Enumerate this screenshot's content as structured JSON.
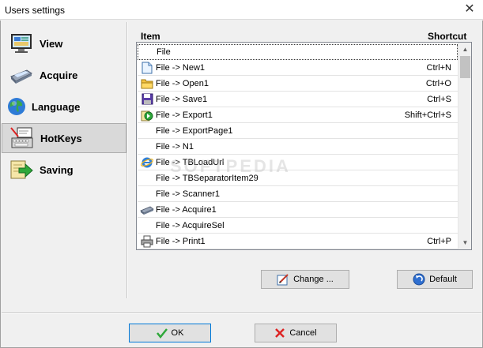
{
  "window": {
    "title": "Users settings",
    "close_glyph": "✕"
  },
  "sidebar": {
    "items": [
      {
        "label": "View",
        "icon": "monitor-icon"
      },
      {
        "label": "Acquire",
        "icon": "scanner-icon"
      },
      {
        "label": "Language",
        "icon": "globe-icon"
      },
      {
        "label": "HotKeys",
        "icon": "keyboard-icon",
        "selected": true
      },
      {
        "label": "Saving",
        "icon": "save-arrow-icon"
      }
    ]
  },
  "hotkeys": {
    "col_item": "Item",
    "col_shortcut": "Shortcut",
    "rows": [
      {
        "item": "File",
        "shortcut": "",
        "icon": ""
      },
      {
        "item": "File -> New1",
        "shortcut": "Ctrl+N",
        "icon": "new-file-icon"
      },
      {
        "item": "File -> Open1",
        "shortcut": "Ctrl+O",
        "icon": "folder-icon"
      },
      {
        "item": "File -> Save1",
        "shortcut": "Ctrl+S",
        "icon": "floppy-icon"
      },
      {
        "item": "File -> Export1",
        "shortcut": "Shift+Ctrl+S",
        "icon": "export-icon"
      },
      {
        "item": "File -> ExportPage1",
        "shortcut": "",
        "icon": ""
      },
      {
        "item": "File -> N1",
        "shortcut": "",
        "icon": ""
      },
      {
        "item": "File -> TBLoadUrl",
        "shortcut": "",
        "icon": "ie-icon"
      },
      {
        "item": "File -> TBSeparatorItem29",
        "shortcut": "",
        "icon": ""
      },
      {
        "item": "File -> Scanner1",
        "shortcut": "",
        "icon": ""
      },
      {
        "item": "File -> Acquire1",
        "shortcut": "",
        "icon": "scanner-icon"
      },
      {
        "item": "File -> AcquireSel",
        "shortcut": "",
        "icon": ""
      },
      {
        "item": "File -> Print1",
        "shortcut": "Ctrl+P",
        "icon": "printer-icon"
      }
    ]
  },
  "buttons": {
    "change": "Change ...",
    "default": "Default",
    "ok": "OK",
    "cancel": "Cancel"
  },
  "watermark": "SOFTPEDIA"
}
